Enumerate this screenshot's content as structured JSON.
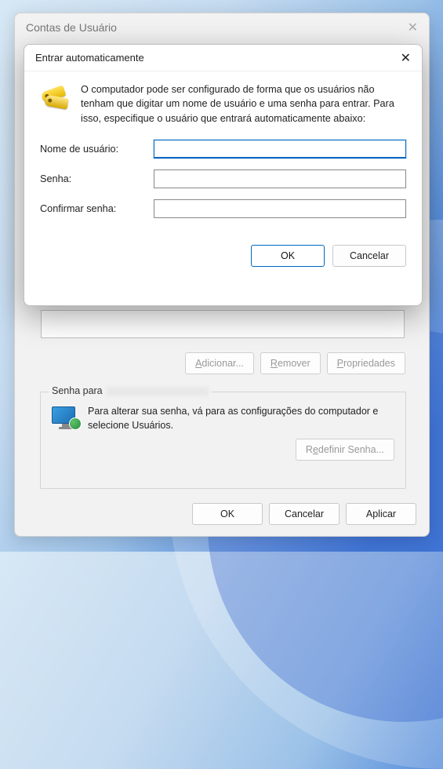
{
  "parent": {
    "title": "Contas de Usuário",
    "buttons": {
      "add": "Adicionar...",
      "remove": "Remover",
      "properties": "Propriedades"
    },
    "password_section": {
      "legend_prefix": "Senha para ",
      "description": "Para alterar sua senha, vá para as configurações do computador e selecione Usuários.",
      "reset_button": "Redefinir Senha..."
    },
    "bottom": {
      "ok": "OK",
      "cancel": "Cancelar",
      "apply": "Aplicar"
    }
  },
  "modal": {
    "title": "Entrar automaticamente",
    "description": "O computador pode ser configurado de forma que os usuários não tenham que digitar um nome de usuário e uma senha para entrar. Para isso, especifique o usuário que entrará automaticamente abaixo:",
    "fields": {
      "username_label": "Nome de usuário:",
      "username_value": "",
      "password_label": "Senha:",
      "password_value": "",
      "confirm_label": "Confirmar senha:",
      "confirm_value": ""
    },
    "buttons": {
      "ok": "OK",
      "cancel": "Cancelar"
    }
  }
}
